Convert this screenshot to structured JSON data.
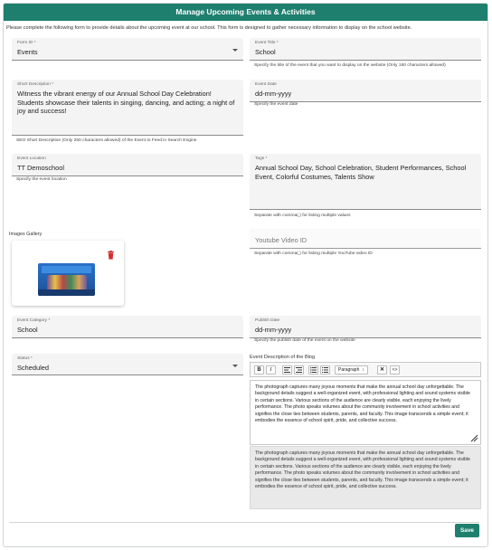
{
  "header": {
    "title": "Manage Upcoming Events & Activities"
  },
  "intro": "Please complete the following form to provide details about the upcoming event at our school. This form is designed to gather necessary information to display on the school website.",
  "form_id": {
    "label": "Form ID *",
    "value": "Events"
  },
  "event_title": {
    "label": "Event Title *",
    "value": "School",
    "help": "Specify the title of the event that you want to display on the website (Only 150 characters allowed)"
  },
  "short_description": {
    "label": "Short Description *",
    "value": "Witness the vibrant energy of our Annual School Day Celebration! Students showcase their talents in singing, dancing, and acting; a night of joy and success!",
    "help": "SEO Short Description (Only 250 characters allowed) of the Event to Feed in Search Engine"
  },
  "event_date": {
    "label": "Event Date",
    "value": "dd-mm-yyyy",
    "help": "Specify the event date"
  },
  "event_location": {
    "label": "Event Location",
    "value": "TT Demoschool",
    "help": "Specify the event location"
  },
  "tags": {
    "label": "Tags *",
    "value": "Annual School Day, School Celebration, Student Performances, School Event, Colorful Costumes, Talents Show",
    "help": "Separate with comma(,) for listing multiple values"
  },
  "gallery": {
    "label": "Images Gallery",
    "delete_icon": "trash-icon"
  },
  "youtube": {
    "placeholder": "Youtube Video ID",
    "help": "Separate with comma(,) for listing multiple YouTube video ID"
  },
  "event_category": {
    "label": "Event Category *",
    "value": "School"
  },
  "publish_date": {
    "label": "Publish Date",
    "value": "dd-mm-yyyy",
    "help": "Specify the publish date of the event on the website"
  },
  "status": {
    "label": "Status *",
    "value": "Scheduled"
  },
  "blog": {
    "label": "Event Description of the Blog",
    "toolbar": {
      "bold": "B",
      "italic": "I",
      "paragraph": "Paragraph",
      "source": "<>"
    },
    "text": "The photograph captures many joyous moments that make the annual school day unforgettable. The background details suggest a well-organized event, with professional lighting and sound systems visible in certain sections. Various sections of the audience are clearly visible, each enjoying the lively performance. The photo speaks volumes about the community involvement in school activities and signifies the close ties between students, parents, and faculty. This image transcends a simple event; it embodies the essence of school spirit, pride, and collective success.",
    "preview": "The photograph captures many joyous moments that make the annual school day unforgettable. The background details suggest a well-organized event, with professional lighting and sound systems visible in certain sections. Various sections of the audience are clearly visible, each enjoying the lively performance. The photo speaks volumes about the community involvement in school activities and signifies the close ties between students, parents, and faculty. This image transcends a simple event; it embodies the essence of school spirit, pride, and collective success."
  },
  "actions": {
    "save": "Save"
  },
  "colors": {
    "accent": "#1f7f6e",
    "delete": "#d32f2f"
  }
}
